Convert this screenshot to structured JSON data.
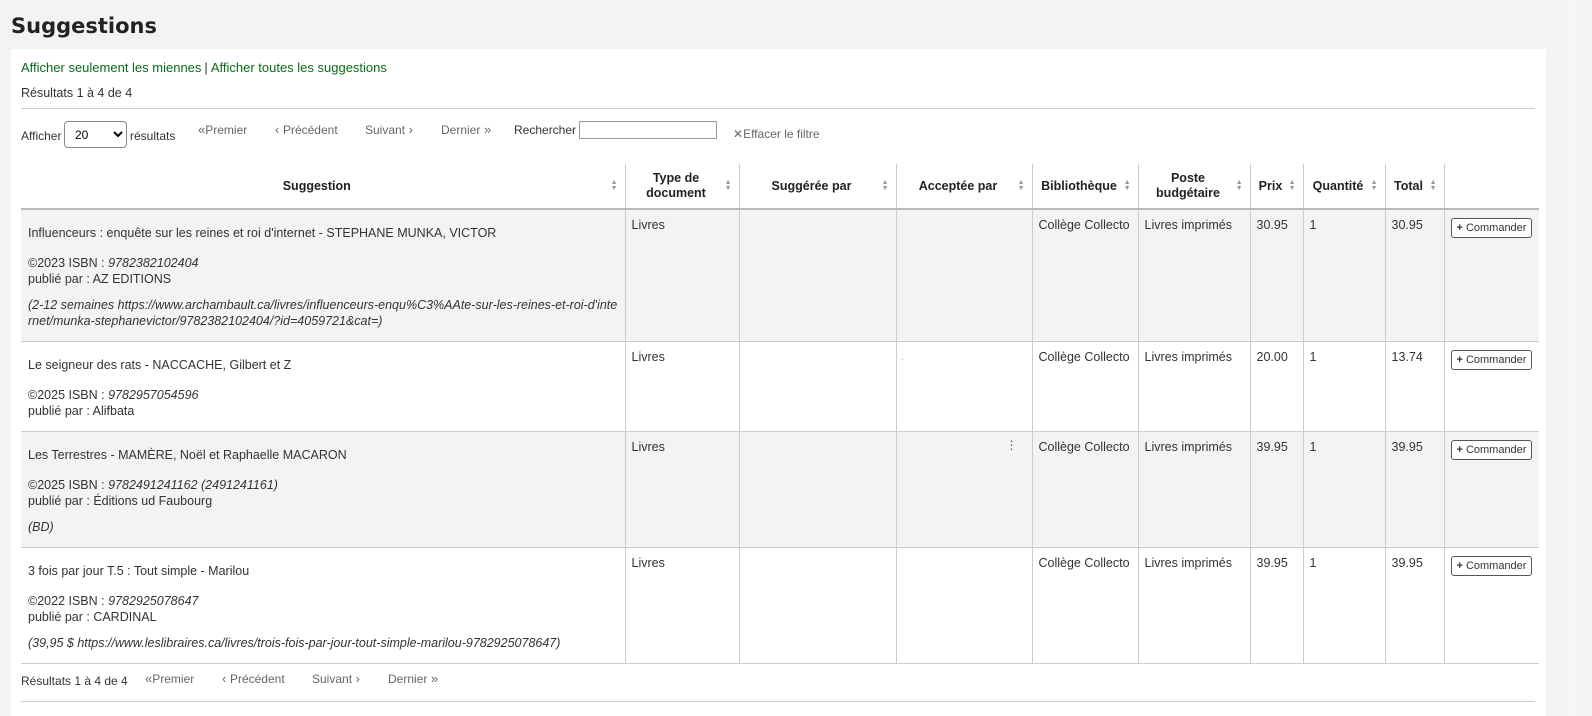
{
  "page": {
    "title": "Suggestions"
  },
  "links": {
    "mine": "Afficher seulement les miennes",
    "sep": "|",
    "all": "Afficher toutes les suggestions"
  },
  "results_text": "Résultats 1 à 4 de 4",
  "toolbar": {
    "show_label": "Afficher",
    "page_size": "20",
    "page_size_options": [
      "20"
    ],
    "results_label": "résultats",
    "first": "Premier",
    "previous": "Précédent",
    "next": "Suivant",
    "last": "Dernier",
    "search_label": "Rechercher :",
    "search_value": "",
    "clear_filter": "Effacer le filtre"
  },
  "columns": [
    "Suggestion",
    "Type de document",
    "Suggérée par",
    "Acceptée par",
    "Bibliothèque",
    "Poste budgétaire",
    "Prix",
    "Quantité",
    "Total"
  ],
  "rows": [
    {
      "title": "Influenceurs : enquête sur les reines et roi d'internet - STEPHANE MUNKA, VICTOR",
      "year_isbn_prefix": "©2023 ISBN : ",
      "isbn": "9782382102404",
      "publisher": "publié par : AZ EDITIONS",
      "note": "(2-12 semaines https://www.archambault.ca/livres/influenceurs-enqu%C3%AAte-sur-les-reines-et-roi-d'internet/munka-stephanevictor/9782382102404/?id=4059721&cat=)",
      "doc_type": "Livres",
      "suggested_by": "",
      "accepted_by": "",
      "library": "Collège Collecto",
      "budget": "Livres imprimés",
      "price": "30.95",
      "quantity": "1",
      "total": "30.95",
      "action": "Commander"
    },
    {
      "title": "Le seigneur des rats - NACCACHE, Gilbert et Z",
      "year_isbn_prefix": "©2025 ISBN : ",
      "isbn": "9782957054596",
      "publisher": "publié par : Alifbata",
      "note": "",
      "doc_type": "Livres",
      "suggested_by": "",
      "accepted_by": "",
      "library": "Collège Collecto",
      "budget": "Livres imprimés",
      "price": "20.00",
      "quantity": "1",
      "total": "13.74",
      "action": "Commander"
    },
    {
      "title": "Les Terrestres - MAMÈRE, Noël et Raphaelle MACARON",
      "year_isbn_prefix": "©2025 ISBN : ",
      "isbn": "9782491241162 (2491241161)",
      "publisher": "publié par : Éditions ud Faubourg",
      "note": "(BD)",
      "doc_type": "Livres",
      "suggested_by": "",
      "accepted_by": "",
      "library": "Collège Collecto",
      "budget": "Livres imprimés",
      "price": "39.95",
      "quantity": "1",
      "total": "39.95",
      "action": "Commander"
    },
    {
      "title": "3 fois par jour T.5 : Tout simple - Marilou",
      "year_isbn_prefix": "©2022 ISBN : ",
      "isbn": "9782925078647",
      "publisher": "publié par : CARDINAL",
      "note": "(39,95 $ https://www.leslibraires.ca/livres/trois-fois-par-jour-tout-simple-marilou-9782925078647)",
      "doc_type": "Livres",
      "suggested_by": "",
      "accepted_by": "",
      "library": "Collège Collecto",
      "budget": "Livres imprimés",
      "price": "39.95",
      "quantity": "1",
      "total": "39.95",
      "action": "Commander"
    }
  ],
  "icons": {
    "sort": "sort-icon",
    "plus": "plus-icon",
    "clear": "x-icon",
    "kebab": "kebab-icon"
  },
  "colors": {
    "link": "#0a6b1a",
    "row_odd": "#f3f3f3"
  }
}
